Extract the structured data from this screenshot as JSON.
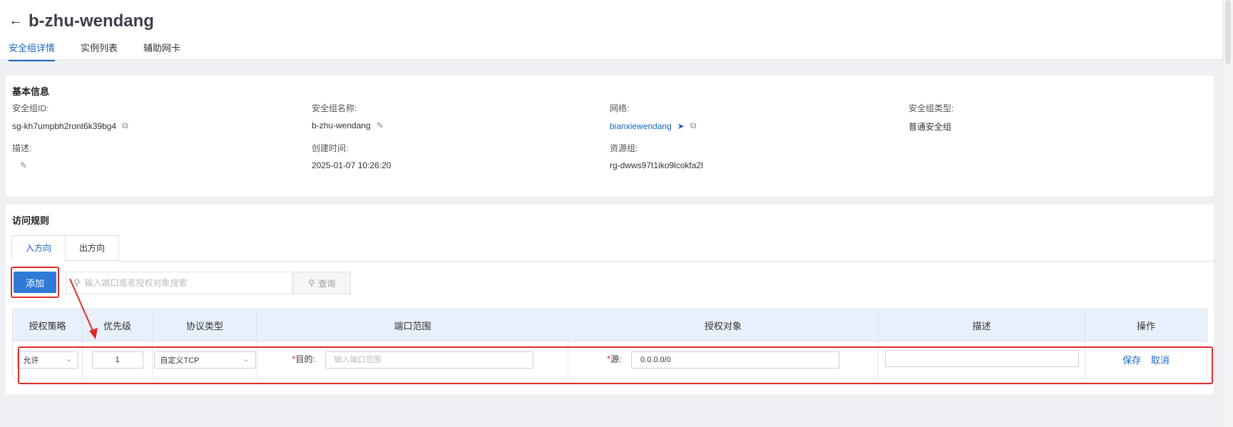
{
  "header": {
    "back_icon": "arrow-left-icon",
    "title": "b-zhu-wendang",
    "tabs": [
      {
        "label": "安全组详情",
        "active": true
      },
      {
        "label": "实例列表",
        "active": false
      },
      {
        "label": "辅助网卡",
        "active": false
      }
    ]
  },
  "basic": {
    "title": "基本信息",
    "sg_id_label": "安全组ID:",
    "sg_id": "sg-kh7umpbh2ront6k39bg4",
    "sg_name_label": "安全组名称:",
    "sg_name": "b-zhu-wendang",
    "network_label": "网络:",
    "network": "bianxiewendang",
    "sg_type_label": "安全组类型:",
    "sg_type": "普通安全组",
    "desc_label": "描述:",
    "created_label": "创建时间:",
    "created": "2025-01-07 10:26:20",
    "rg_label": "资源组:",
    "rg": "rg-dwws97t1iko9lcokfa2l"
  },
  "rules": {
    "title": "访问规则",
    "tabs": [
      {
        "label": "入方向",
        "active": true
      },
      {
        "label": "出方向",
        "active": false
      }
    ],
    "add_label": "添加",
    "search_placeholder": "输入端口或者授权对象搜索",
    "query_label": "查询",
    "columns": [
      "授权策略",
      "优先级",
      "协议类型",
      "端口范围",
      "授权对象",
      "描述",
      "操作"
    ],
    "row": {
      "policy": "允许",
      "priority": "1",
      "protocol": "自定义TCP",
      "dest_label": "目的:",
      "port_placeholder": "输入端口范围",
      "source_label": "源:",
      "source_value": "0.0.0.0/0",
      "description": "",
      "save": "保存",
      "cancel": "取消"
    }
  },
  "colors": {
    "accent": "#1a63c6",
    "primary_button": "#2e7ad6",
    "highlight": "#e02b27",
    "table_header": "#e8f0fb"
  }
}
